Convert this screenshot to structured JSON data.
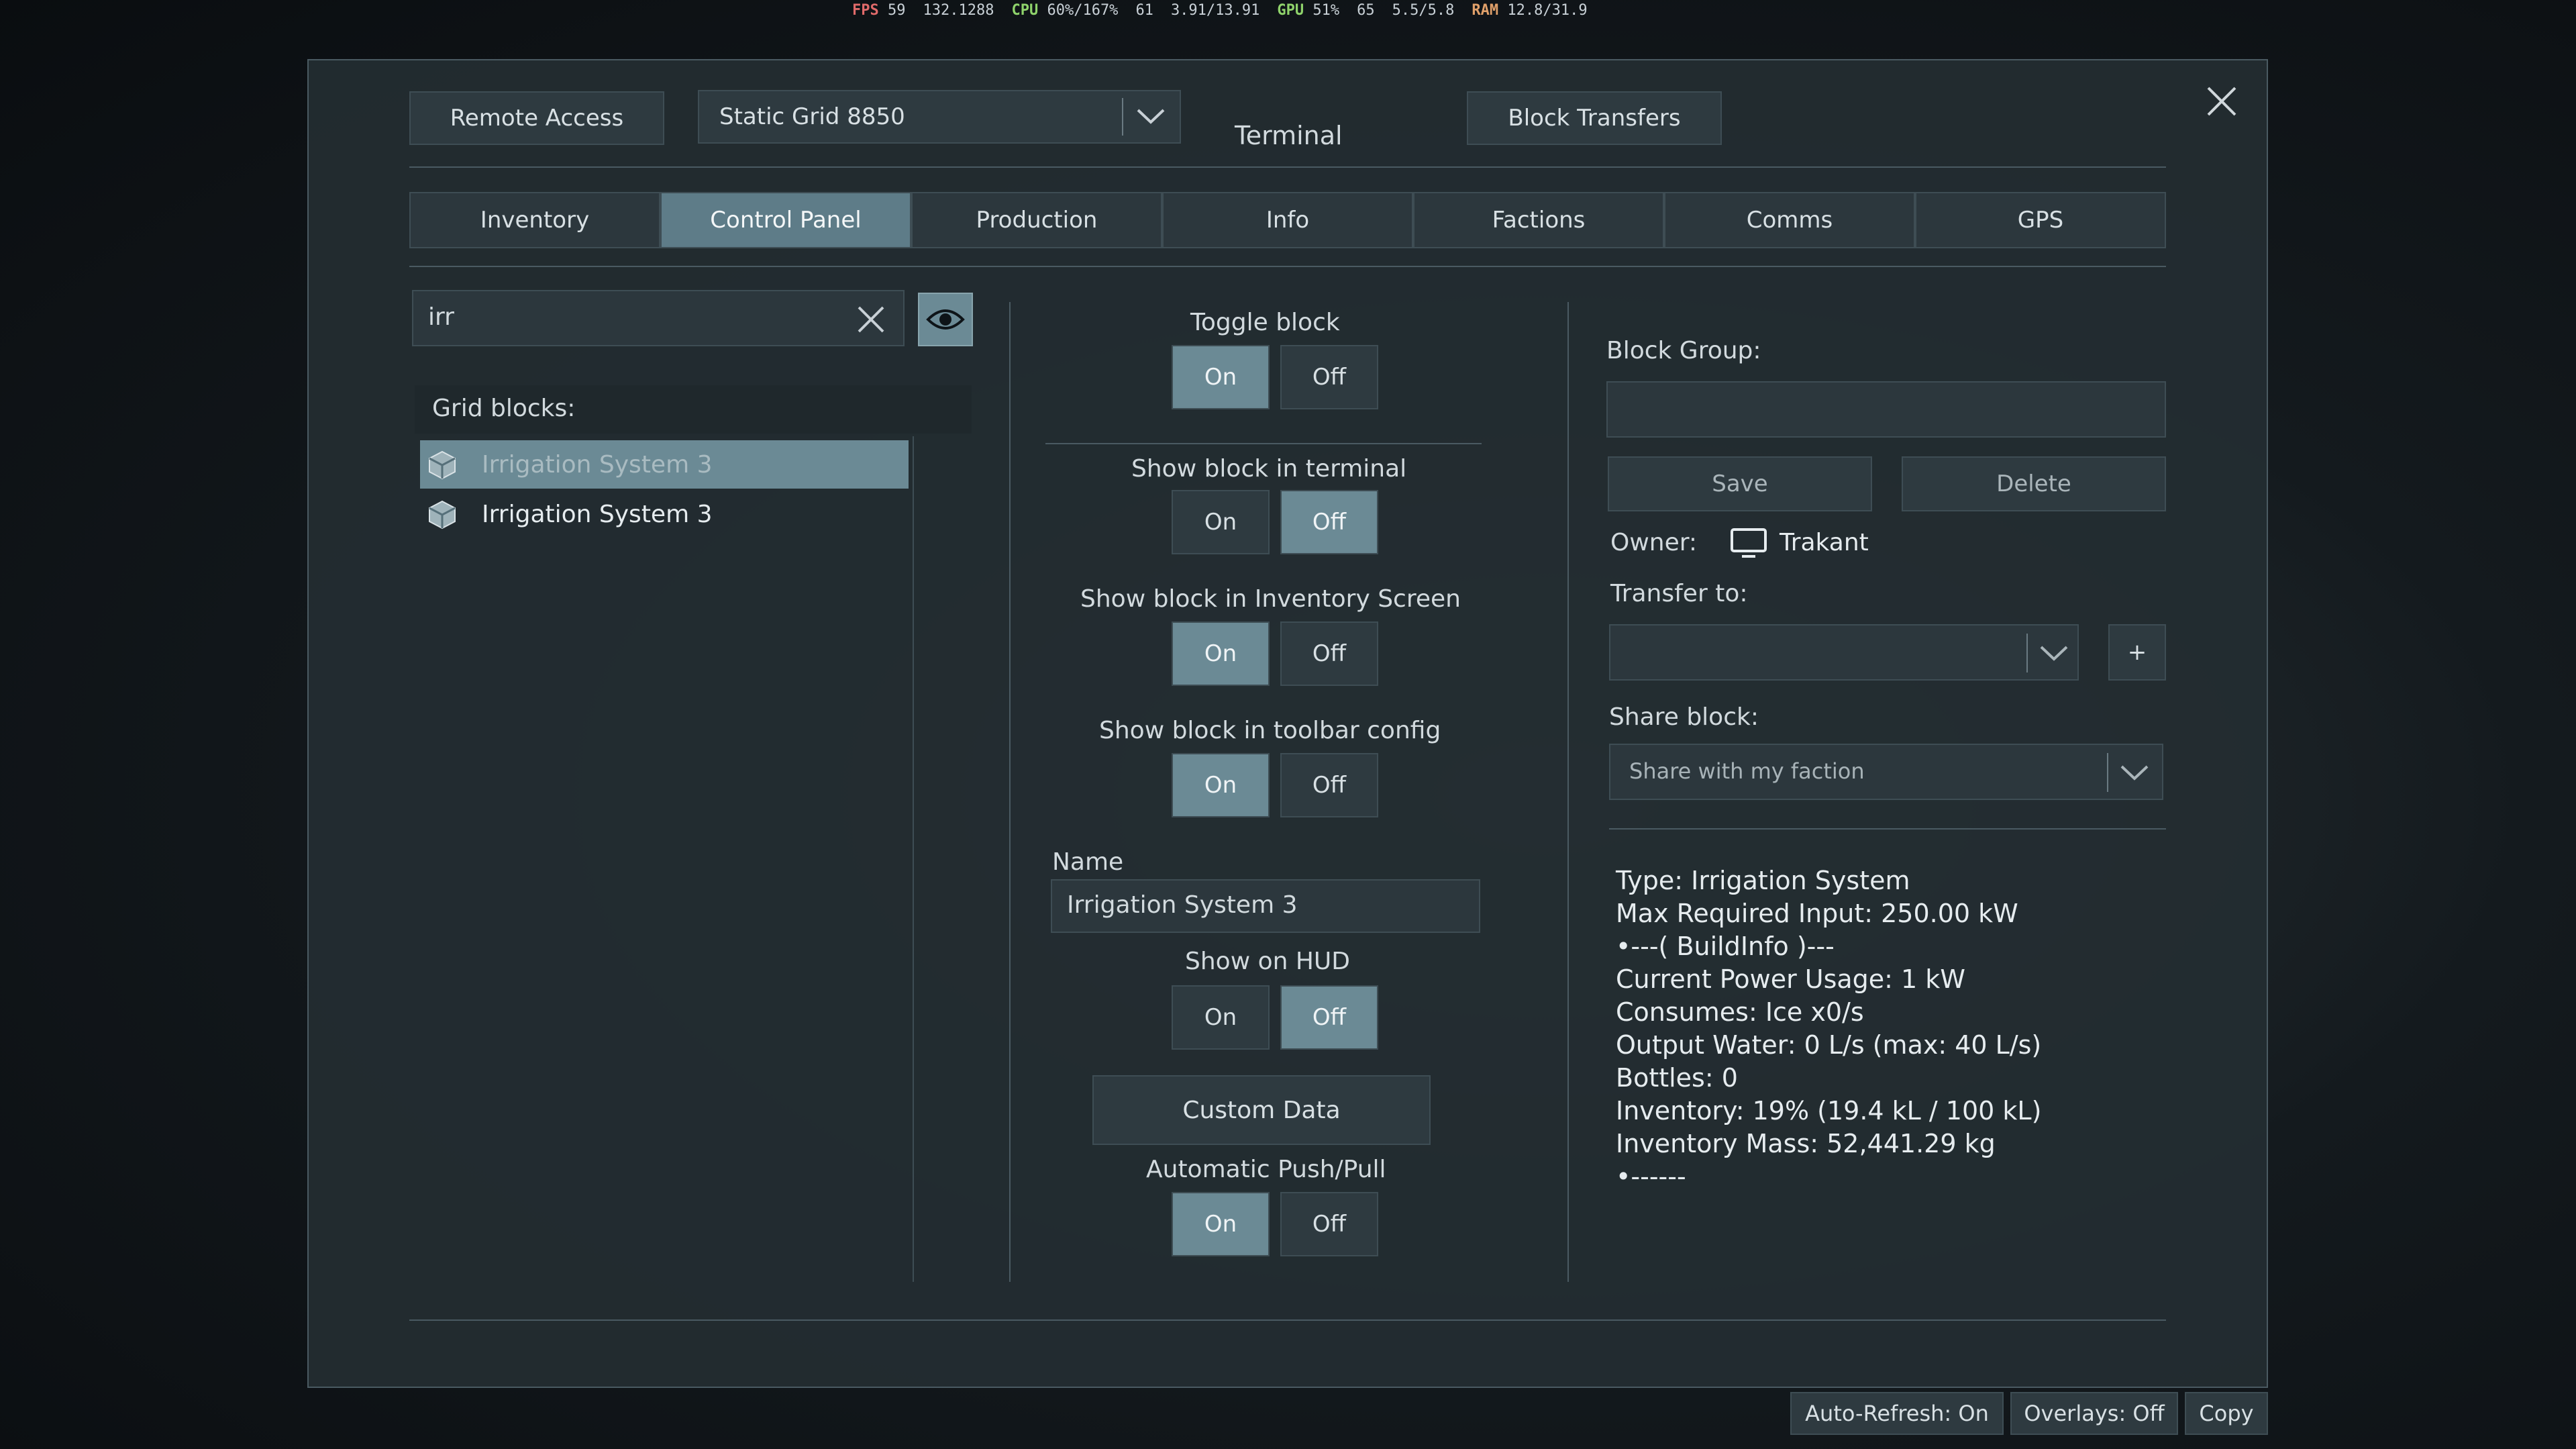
{
  "perf": {
    "fps_label": "FPS",
    "fps": "59",
    "frame": "132.1288",
    "cpu_label": "CPU",
    "cpu": "60%/167%",
    "mem1": "61",
    "mem2": "3.91/13.91",
    "gpu_label": "GPU",
    "gpu": "51%",
    "gpu_temp": "65",
    "gpu_mem": "5.5/5.8",
    "ram_label": "RAM",
    "ram": "12.8/31.9"
  },
  "header": {
    "remote_access": "Remote Access",
    "grid_select": "Static Grid 8850",
    "title": "Terminal",
    "block_transfers": "Block Transfers"
  },
  "tabs": [
    {
      "label": "Inventory"
    },
    {
      "label": "Control Panel"
    },
    {
      "label": "Production"
    },
    {
      "label": "Info"
    },
    {
      "label": "Factions"
    },
    {
      "label": "Comms"
    },
    {
      "label": "GPS"
    }
  ],
  "search": {
    "value": "irr"
  },
  "grid_blocks": {
    "title": "Grid blocks:",
    "items": [
      {
        "label": "Irrigation System 3"
      },
      {
        "label": "Irrigation System 3"
      }
    ]
  },
  "controls": {
    "on": "On",
    "off": "Off",
    "toggle_block": "Toggle block",
    "show_terminal": "Show block in terminal",
    "show_inventory": "Show block in Inventory Screen",
    "show_toolbar": "Show block in toolbar config",
    "name_label": "Name",
    "name_value": "Irrigation System 3",
    "show_hud": "Show on HUD",
    "custom_data": "Custom Data",
    "auto_push_pull": "Automatic Push/Pull"
  },
  "right": {
    "block_group": "Block Group:",
    "save": "Save",
    "delete": "Delete",
    "owner_label": "Owner:",
    "owner_name": "Trakant",
    "transfer_to": "Transfer to:",
    "add": "+",
    "share_block": "Share block:",
    "share_value": "Share with my faction"
  },
  "info": [
    "Type: Irrigation System",
    "Max Required Input: 250.00 kW",
    "•---( BuildInfo )---",
    "Current Power Usage: 1 kW",
    "Consumes: Ice x0/s",
    "Output Water: 0 L/s (max: 40 L/s)",
    "Bottles: 0",
    "Inventory: 19% (19.4 kL / 100 kL)",
    "Inventory Mass: 52,441.29 kg",
    "•------"
  ],
  "status": {
    "auto_refresh": "Auto-Refresh: On",
    "overlays": "Overlays: Off",
    "copy": "Copy"
  }
}
